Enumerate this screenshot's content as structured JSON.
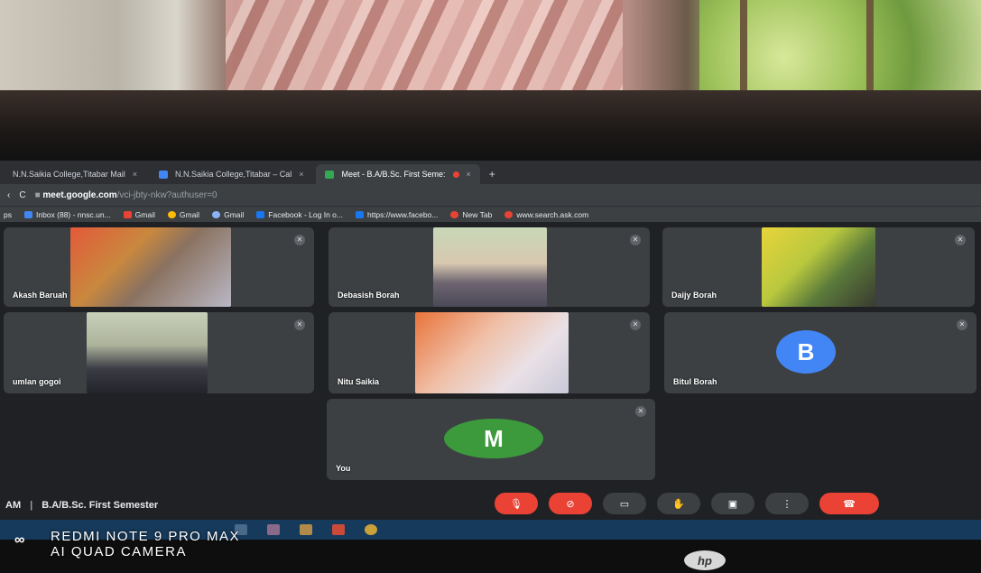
{
  "browser": {
    "tabs": [
      {
        "label": "N.N.Saikia College,Titabar Mail",
        "active": false
      },
      {
        "label": "N.N.Saikia College,Titabar – Cal",
        "active": false
      },
      {
        "label": "Meet - B.A/B.Sc. First Seme:",
        "active": true
      }
    ],
    "new_tab": "+",
    "close": "×",
    "url_host": "meet.google.com",
    "url_path": "/vci-jbty-nkw?authuser=0",
    "bookmarks": [
      "ps",
      "Inbox (88) - nnsc.un...",
      "Gmail",
      "Gmail",
      "Gmail",
      "Facebook - Log In o...",
      "https://www.facebo...",
      "New Tab",
      "www.search.ask.com"
    ]
  },
  "meet": {
    "participants": [
      {
        "name": "Akash Baruah"
      },
      {
        "name": "Debasish Borah"
      },
      {
        "name": "Daijy Borah"
      },
      {
        "name": "umlan gogoi"
      },
      {
        "name": "Nitu Saikia"
      },
      {
        "name": "Bitul Borah",
        "avatar_letter": "B",
        "avatar_color": "#4285f4"
      },
      {
        "name": "You",
        "avatar_letter": "M",
        "avatar_color": "#3c9a3c"
      }
    ],
    "time_suffix": "AM",
    "separator": "|",
    "meeting_title": "B.A/B.Sc. First Semester"
  },
  "watermark": {
    "line1": "REDMI NOTE 9 PRO MAX",
    "line2": "AI QUAD CAMERA"
  },
  "laptop_brand": "hp"
}
